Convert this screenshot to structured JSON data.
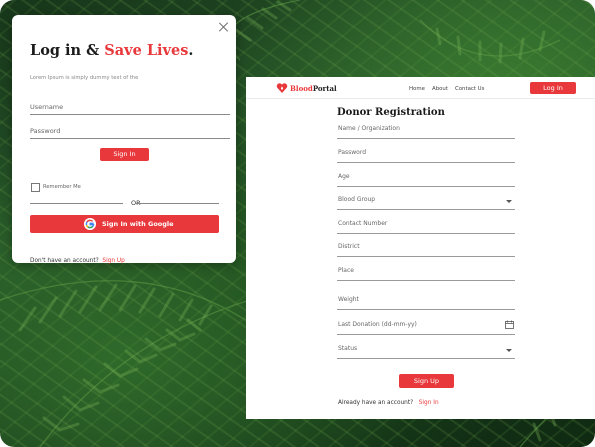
{
  "login": {
    "title_part1": "Log in & ",
    "title_accent": "Save Lives",
    "title_period": ".",
    "subtitle": "Lorem Ipsum is simply dummy text of the",
    "username_placeholder": "Username",
    "password_placeholder": "Password",
    "signin_label": "Sign In",
    "remember_label": "Remember Me",
    "or_label": "OR",
    "google_label": "Sign In with Google",
    "no_account_text": "Don't have an account?",
    "signup_link": "Sign Up"
  },
  "nav": {
    "brand_part1": "Blood",
    "brand_part2": "Portal",
    "links": [
      "Home",
      "About",
      "Contact Us"
    ],
    "login_label": "Log In"
  },
  "register": {
    "title": "Donor Registration",
    "fields": [
      "Name / Organization",
      "Password",
      "Age",
      "Blood Group",
      "Contact Number",
      "District",
      "Place",
      "Weight",
      "Last Donation (dd-mm-yy)",
      "Status"
    ],
    "signup_label": "Sign Up",
    "already_text": "Already have an account?",
    "signin_link": "Sign In"
  },
  "colors": {
    "accent": "#e8383b",
    "background_foliage": "#1f4a22"
  },
  "icons": [
    "close-icon",
    "google-icon",
    "heart-icon",
    "chevron-down-icon",
    "calendar-icon"
  ]
}
